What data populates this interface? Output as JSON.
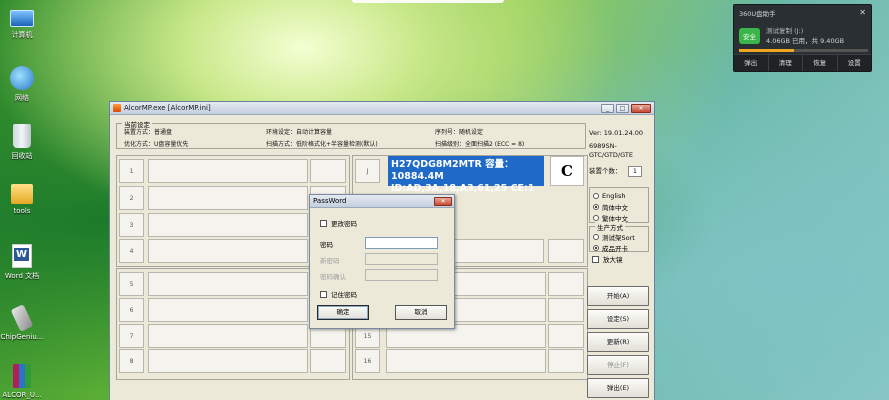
{
  "desktop": {
    "icons": [
      {
        "label": "计算机",
        "icon": "computer-icon"
      },
      {
        "label": "网络",
        "icon": "network-icon"
      },
      {
        "label": "回收站",
        "icon": "recycle-bin-icon"
      },
      {
        "label": "tools",
        "icon": "folder-icon"
      },
      {
        "label": "Word 文档",
        "icon": "word-document-icon"
      },
      {
        "label": "ChipGeniu...",
        "icon": "usb-drive-icon"
      },
      {
        "label": "ALCOR_U...",
        "icon": "winrar-archive-icon"
      }
    ]
  },
  "widget360": {
    "title": "360U盘助手",
    "close": "✕",
    "badge": "安全",
    "disk_name": "测试复制 (J:)",
    "capacity": "4.06GB 已用，共 9.40GB",
    "usage_fraction": 0.43,
    "tools": [
      "弹出",
      "清理",
      "恢复",
      "设置"
    ]
  },
  "window": {
    "title": "AlcorMP.exe [AlcorMP.ini]",
    "buttons": [
      "_",
      "□",
      "✕"
    ],
    "settings_group": "当前设定",
    "settings": [
      "装置方式：普通盘",
      "环境设定：自动计算容量",
      "序列号：随机设定",
      "优化方式：U盘容量优先",
      "扫描方式：低阶格式化+半容量检测(默认)",
      "扫描级别：全面扫描2 (ECC = 8)"
    ],
    "version": "Ver: 19.01.24.00",
    "chip": "6989SN-GTC/GTD/GTE",
    "device_count_label": "装置个数：",
    "device_count": "1",
    "ports_left": [
      "1",
      "2",
      "3",
      "4",
      "5",
      "6",
      "7",
      "8"
    ],
    "port_j": "J",
    "ports_right_visible": [
      "15",
      "16"
    ],
    "drive_info_line1": "H27QDG8M2MTR 容量：10884.4M",
    "drive_info_line2": "ID:AD,3A,18,A3,61,25 CE:1 (Block)",
    "drive_letter": "C",
    "languages": [
      {
        "label": "English",
        "selected": false
      },
      {
        "label": "简体中文",
        "selected": true
      },
      {
        "label": "繁体中文",
        "selected": false
      }
    ],
    "prod_group": "生产方式",
    "prod_modes": [
      {
        "label": "测试架Sort",
        "selected": false
      },
      {
        "label": "成品开卡",
        "selected": true
      }
    ],
    "magnify_label": "放大镜",
    "actions": {
      "start": "开始(A)",
      "settings": "设定(S)",
      "refresh": "更新(R)",
      "stop": "停止(F)",
      "eject": "弹出(E)"
    }
  },
  "password_dialog": {
    "title": "PassWord",
    "close": "✕",
    "change_password": "更改密码",
    "password_label": "密码",
    "new_password_label": "新密码",
    "confirm_password_label": "密码确认",
    "remember_password": "记住密码",
    "ok": "确定",
    "cancel": "取消"
  },
  "colors": {
    "info_blue": "#1f6ac9",
    "safe_green": "#3ab54a",
    "usage_orange": "#f0a51e"
  }
}
